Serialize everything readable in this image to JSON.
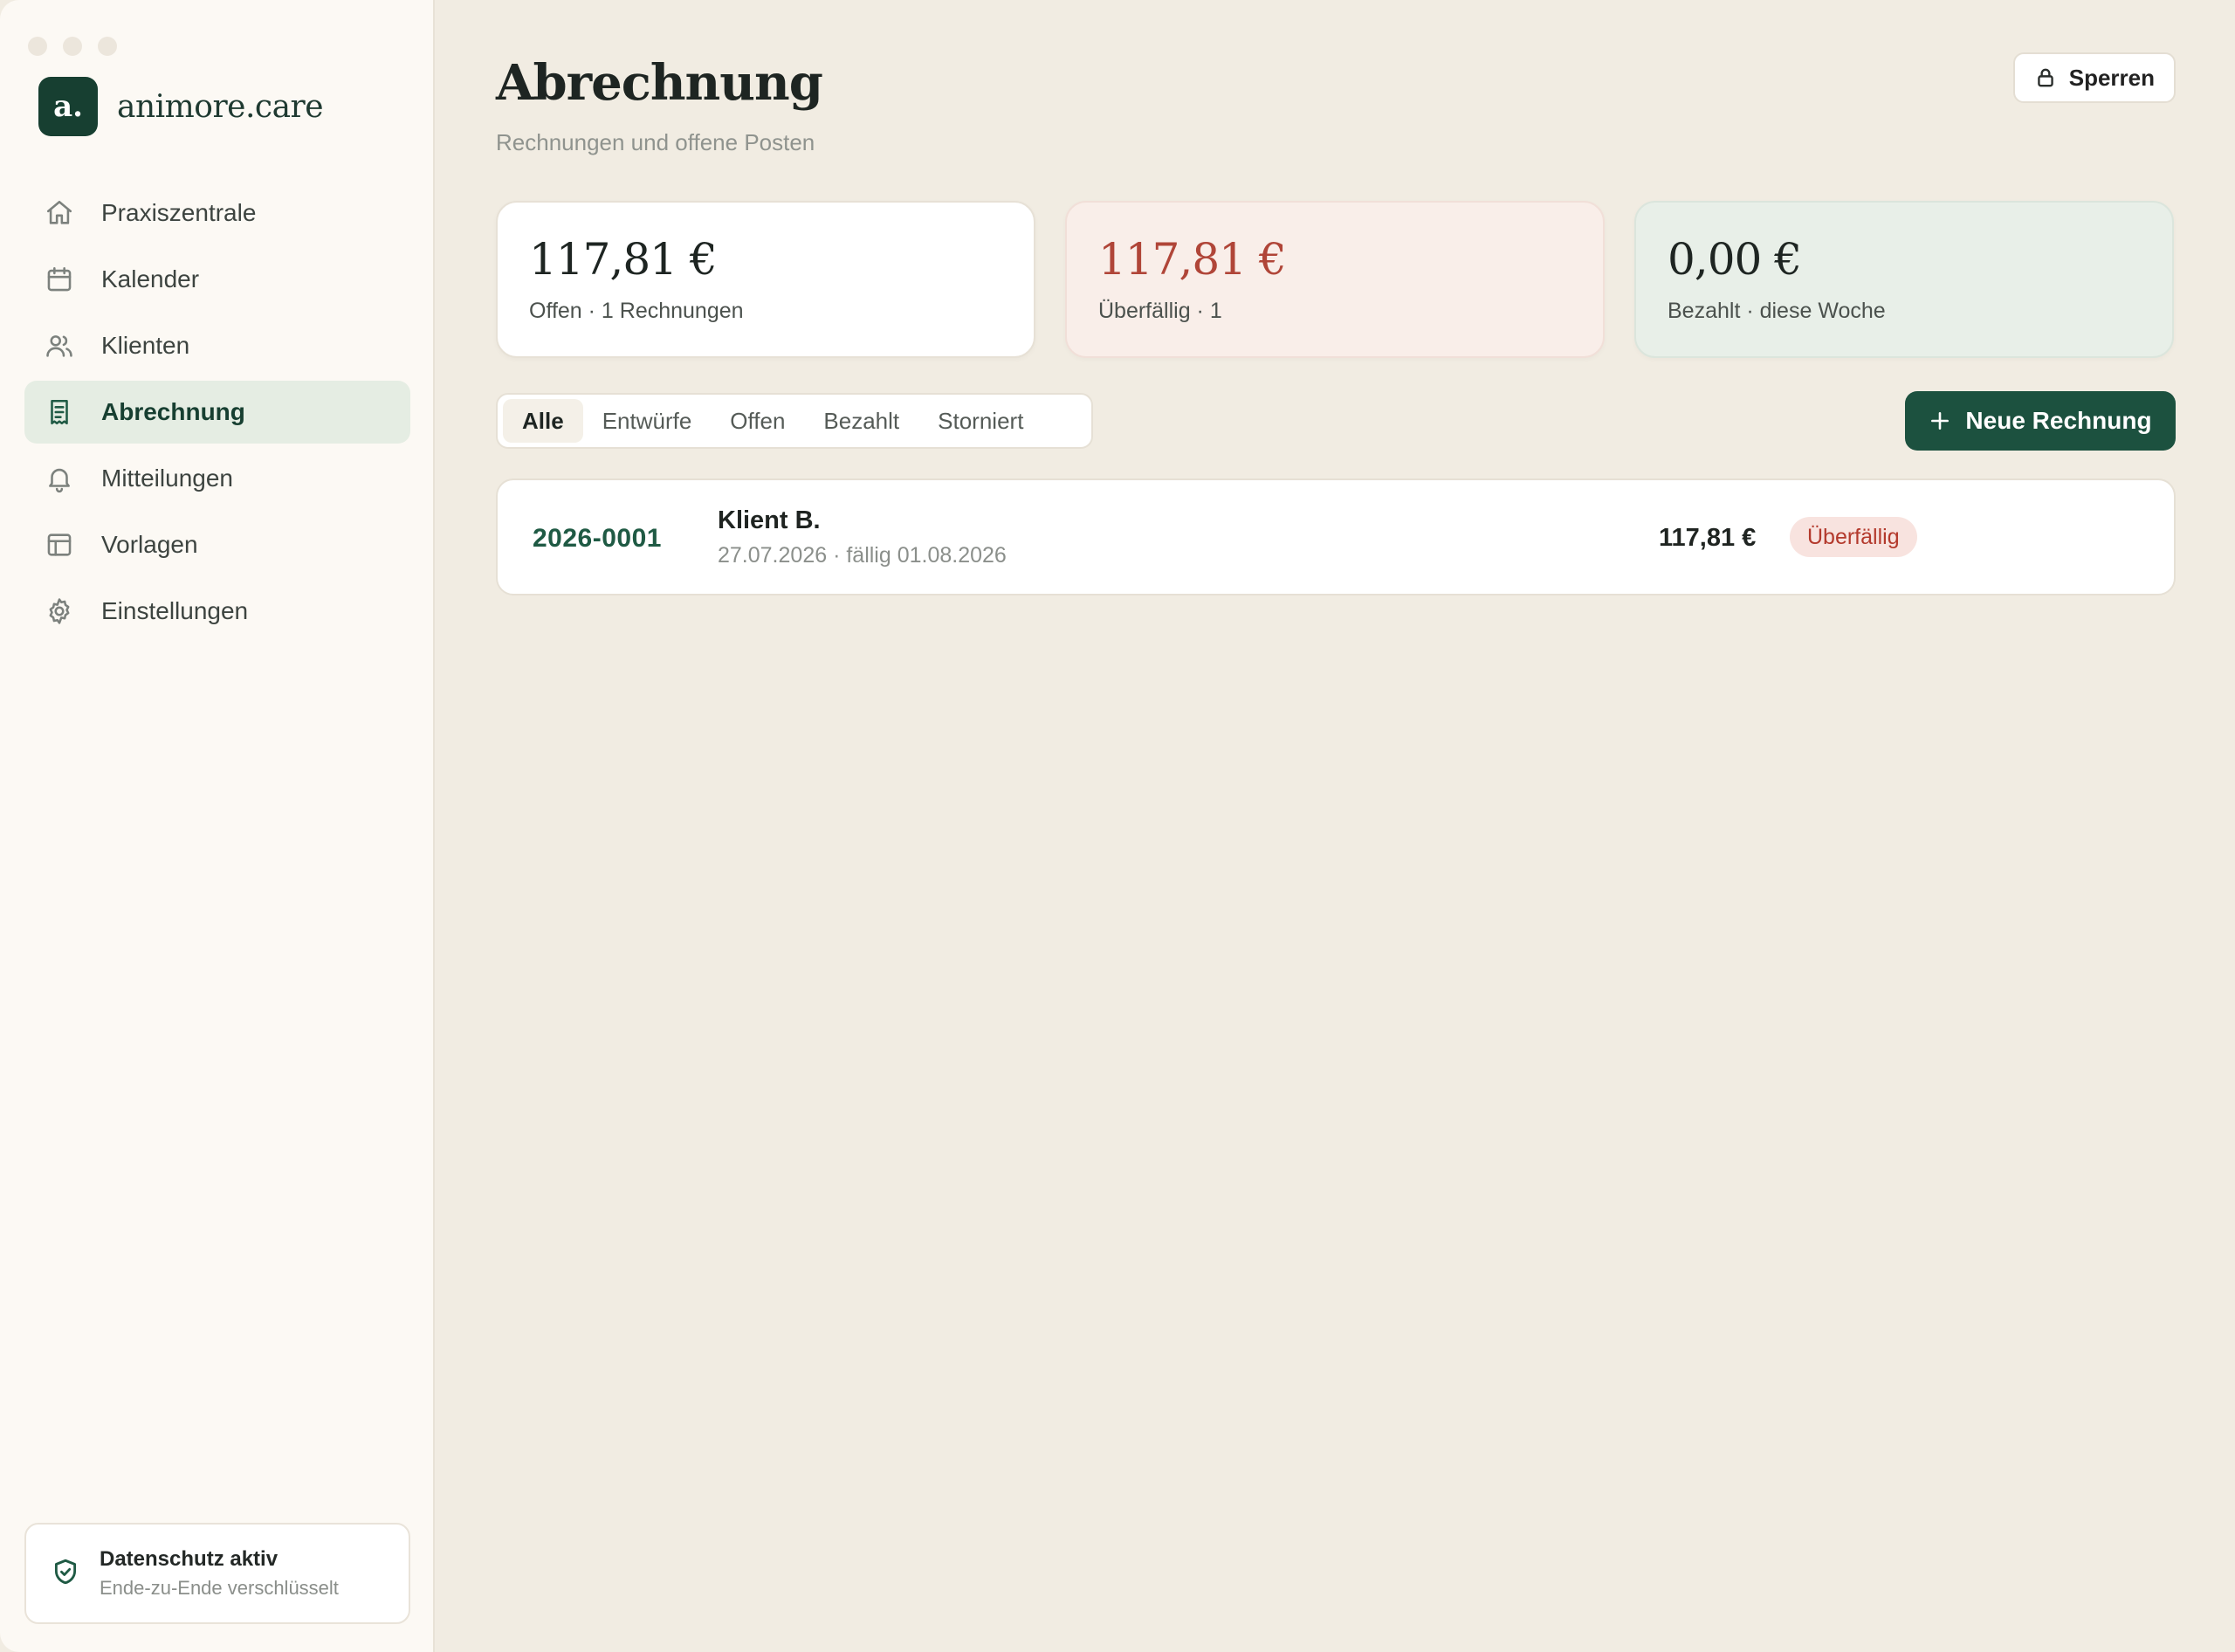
{
  "app": {
    "logo_letter": "a.",
    "name": "animore.care"
  },
  "sidebar": {
    "items": [
      {
        "label": "Praxiszentrale",
        "icon": "home-icon",
        "active": false
      },
      {
        "label": "Kalender",
        "icon": "calendar-icon",
        "active": false
      },
      {
        "label": "Klienten",
        "icon": "users-icon",
        "active": false
      },
      {
        "label": "Abrechnung",
        "icon": "receipt-icon",
        "active": true
      },
      {
        "label": "Mitteilungen",
        "icon": "bell-icon",
        "active": false
      },
      {
        "label": "Vorlagen",
        "icon": "template-icon",
        "active": false
      },
      {
        "label": "Einstellungen",
        "icon": "gear-icon",
        "active": false
      }
    ],
    "privacy": {
      "title": "Datenschutz aktiv",
      "subtitle": "Ende-zu-Ende verschlüsselt",
      "icon": "shield-check-icon"
    }
  },
  "header": {
    "title": "Abrechnung",
    "subtitle": "Rechnungen und offene Posten",
    "lock_label": "Sperren"
  },
  "summary": {
    "open": {
      "amount": "117,81 €",
      "label": "Offen · 1 Rechnungen"
    },
    "overdue": {
      "amount": "117,81 €",
      "label": "Überfällig · 1"
    },
    "paid": {
      "amount": "0,00 €",
      "label": "Bezahlt · diese Woche"
    }
  },
  "filters": {
    "tabs": [
      "Alle",
      "Entwürfe",
      "Offen",
      "Bezahlt",
      "Storniert"
    ],
    "active": "Alle"
  },
  "new_invoice_label": "Neue Rechnung",
  "invoices": [
    {
      "number": "2026-0001",
      "client": "Klient B.",
      "dates": "27.07.2026 · fällig 01.08.2026",
      "amount": "117,81 €",
      "status": "Überfällig"
    }
  ],
  "colors": {
    "brand": "#173f31",
    "accent": "#1c513f",
    "overdue": "#b04538",
    "background": "#f1ece2"
  }
}
